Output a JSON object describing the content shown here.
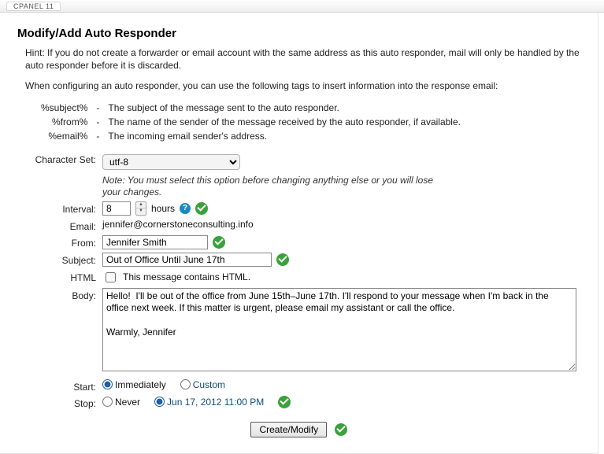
{
  "topbar": {
    "label": "CPANEL 11"
  },
  "heading": "Modify/Add Auto Responder",
  "hint": "Hint: If you do not create a forwarder or email account with the same address as this auto responder, mail will only be handled by the auto responder before it is discarded.",
  "intro": "When configuring an auto responder, you can use the following tags to insert information into the response email:",
  "tags": [
    {
      "name": "%subject%",
      "desc": "The subject of the message sent to the auto responder."
    },
    {
      "name": "%from%",
      "desc": "The name of the sender of the message received by the auto responder, if available."
    },
    {
      "name": "%email%",
      "desc": "The incoming email sender's address."
    }
  ],
  "charset": {
    "label": "Character Set:",
    "value": "utf-8",
    "note": "Note: You must select this option before changing anything else or you will lose your changes."
  },
  "interval": {
    "label": "Interval:",
    "value": "8",
    "unit": "hours"
  },
  "email": {
    "label": "Email:",
    "value": "jennifer@cornerstoneconsulting.info"
  },
  "from": {
    "label": "From:",
    "value": "Jennifer Smith"
  },
  "subject": {
    "label": "Subject:",
    "value": "Out of Office Until June 17th"
  },
  "html": {
    "label": "HTML",
    "checkbox_label": "This message contains HTML."
  },
  "body": {
    "label": "Body:",
    "value": "Hello!  I'll be out of the office from June 15th–June 17th. I'll respond to your message when I'm back in the office next week. If this matter is urgent, please email my assistant or call the office.\n\nWarmly, Jennifer"
  },
  "start": {
    "label": "Start:",
    "options": {
      "immediately": "Immediately",
      "custom": "Custom"
    },
    "selected": "immediately"
  },
  "stop": {
    "label": "Stop:",
    "options": {
      "never": "Never",
      "custom": "Jun 17, 2012 11:00 PM"
    },
    "selected": "custom"
  },
  "submit": {
    "label": "Create/Modify"
  }
}
